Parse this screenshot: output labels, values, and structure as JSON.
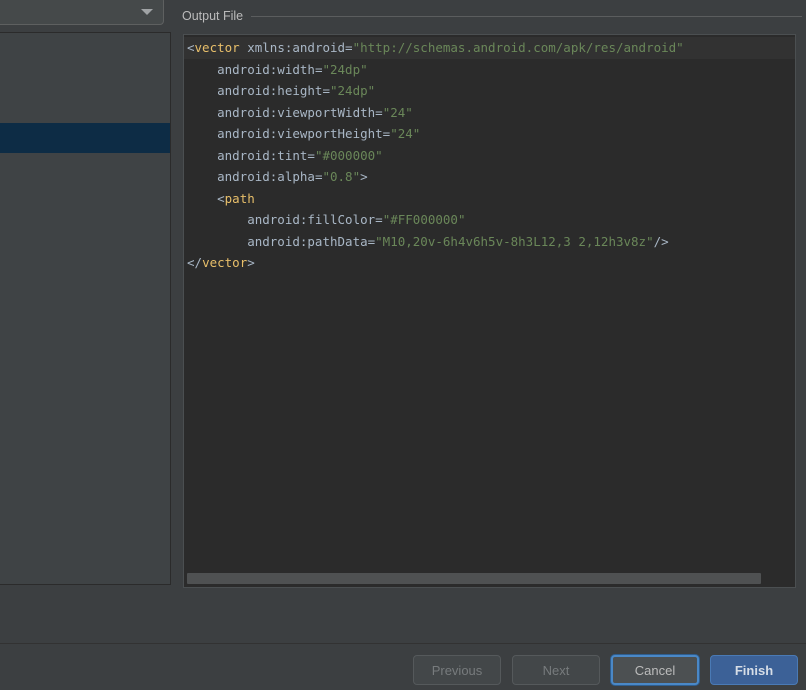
{
  "window": {
    "background_color": "#3c3f41"
  },
  "left_panel": {
    "combo": {
      "name": "asset-type-combobox",
      "value": "",
      "arrow_icon": "chevron-down-icon"
    },
    "list": {
      "rows": [
        {
          "label": "",
          "selected": false
        },
        {
          "label": "",
          "selected": false
        },
        {
          "label": "",
          "selected": false
        },
        {
          "label": "",
          "selected": true
        },
        {
          "label": "",
          "selected": false
        },
        {
          "label": "",
          "selected": false
        },
        {
          "label": "",
          "selected": false
        },
        {
          "label": "",
          "selected": false
        },
        {
          "label": "",
          "selected": false
        },
        {
          "label": "",
          "selected": false
        },
        {
          "label": "",
          "selected": false
        },
        {
          "label": "",
          "selected": false
        },
        {
          "label": "",
          "selected": false
        },
        {
          "label": "",
          "selected": false
        },
        {
          "label": "",
          "selected": false
        },
        {
          "label": "",
          "selected": false
        },
        {
          "label": "",
          "selected": false
        },
        {
          "label": "",
          "selected": false
        }
      ],
      "selected_row_color": "#0d2c45"
    }
  },
  "right_panel": {
    "section_title": "Output File",
    "editor": {
      "background_color": "#2b2b2b",
      "current_line_color": "#323232",
      "syntax_colors": {
        "tag": "#e8bf6a",
        "attribute": "#a9b7c6",
        "string": "#6a8759",
        "punctuation": "#a9b7c6"
      },
      "code_text": "<vector xmlns:android=\"http://schemas.android.com/apk/res/android\"\n    android:width=\"24dp\"\n    android:height=\"24dp\"\n    android:viewportWidth=\"24\"\n    android:viewportHeight=\"24\"\n    android:tint=\"#000000\"\n    android:alpha=\"0.8\">\n    <path\n        android:fillColor=\"#FF000000\"\n        android:pathData=\"M10,20v-6h4v6h5v-8h3L12,3 2,12h3v8z\"/>\n</vector>",
      "lines": [
        {
          "current": true,
          "tokens": [
            {
              "t": "punc",
              "v": "<"
            },
            {
              "t": "tag",
              "v": "vector"
            },
            {
              "t": "attr",
              "v": " xmlns:android"
            },
            {
              "t": "eq",
              "v": "="
            },
            {
              "t": "str",
              "v": "\"http://schemas.android.com/apk/res/android\""
            }
          ]
        },
        {
          "current": false,
          "tokens": [
            {
              "t": "attr",
              "v": "    android:width"
            },
            {
              "t": "eq",
              "v": "="
            },
            {
              "t": "str",
              "v": "\"24dp\""
            }
          ]
        },
        {
          "current": false,
          "tokens": [
            {
              "t": "attr",
              "v": "    android:height"
            },
            {
              "t": "eq",
              "v": "="
            },
            {
              "t": "str",
              "v": "\"24dp\""
            }
          ]
        },
        {
          "current": false,
          "tokens": [
            {
              "t": "attr",
              "v": "    android:viewportWidth"
            },
            {
              "t": "eq",
              "v": "="
            },
            {
              "t": "str",
              "v": "\"24\""
            }
          ]
        },
        {
          "current": false,
          "tokens": [
            {
              "t": "attr",
              "v": "    android:viewportHeight"
            },
            {
              "t": "eq",
              "v": "="
            },
            {
              "t": "str",
              "v": "\"24\""
            }
          ]
        },
        {
          "current": false,
          "tokens": [
            {
              "t": "attr",
              "v": "    android:tint"
            },
            {
              "t": "eq",
              "v": "="
            },
            {
              "t": "str",
              "v": "\"#000000\""
            }
          ]
        },
        {
          "current": false,
          "tokens": [
            {
              "t": "attr",
              "v": "    android:alpha"
            },
            {
              "t": "eq",
              "v": "="
            },
            {
              "t": "str",
              "v": "\"0.8\""
            },
            {
              "t": "punc",
              "v": ">"
            }
          ]
        },
        {
          "current": false,
          "tokens": [
            {
              "t": "punc",
              "v": "    <"
            },
            {
              "t": "tag",
              "v": "path"
            }
          ]
        },
        {
          "current": false,
          "tokens": [
            {
              "t": "attr",
              "v": "        android:fillColor"
            },
            {
              "t": "eq",
              "v": "="
            },
            {
              "t": "str",
              "v": "\"#FF000000\""
            }
          ]
        },
        {
          "current": false,
          "tokens": [
            {
              "t": "attr",
              "v": "        android:pathData"
            },
            {
              "t": "eq",
              "v": "="
            },
            {
              "t": "str",
              "v": "\"M10,20v-6h4v6h5v-8h3L12,3 2,12h3v8z\""
            },
            {
              "t": "punc",
              "v": "/>"
            }
          ]
        },
        {
          "current": false,
          "tokens": [
            {
              "t": "punc",
              "v": "</"
            },
            {
              "t": "tag",
              "v": "vector"
            },
            {
              "t": "punc",
              "v": ">"
            }
          ]
        }
      ]
    },
    "horizontal_scrollbar": {
      "name": "editor-horizontal-scrollbar",
      "thumb_color": "#4f5152"
    }
  },
  "bottom_bar": {
    "buttons": [
      {
        "name": "previous-button",
        "label": "Previous",
        "state": "disabled"
      },
      {
        "name": "next-button",
        "label": "Next",
        "state": "disabled"
      },
      {
        "name": "cancel-button",
        "label": "Cancel",
        "state": "focused"
      },
      {
        "name": "finish-button",
        "label": "Finish",
        "state": "primary"
      }
    ],
    "primary_color": "#3c6197",
    "focus_color": "#4a88c7"
  }
}
